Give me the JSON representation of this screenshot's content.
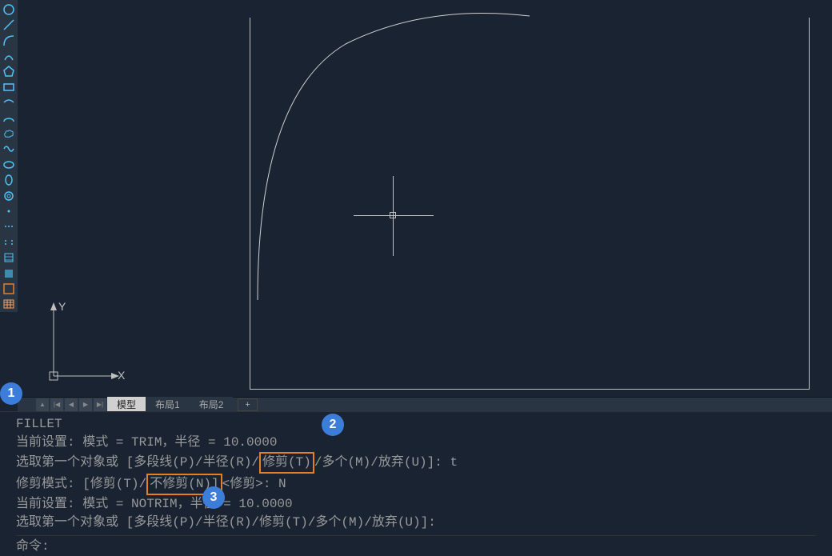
{
  "toolbar_icons": [
    "circle-icon",
    "line-icon",
    "arc-small-icon",
    "arc-outline-icon",
    "pentagon-icon",
    "rectangle-icon",
    "arc-icon",
    "ellipse-arc-icon",
    "cloud-icon",
    "spline-icon",
    "ellipse-icon",
    "ellipse2-icon",
    "revcloud-icon",
    "point-icon",
    "dots-icon",
    "dots2-icon",
    "hatch-icon",
    "gradient-icon",
    "block-icon",
    "table-icon"
  ],
  "ucs": {
    "x": "X",
    "y": "Y"
  },
  "nav": {
    "lock": "▲",
    "first": "|◀",
    "prev": "◀",
    "next": "▶",
    "last": "▶|"
  },
  "tabs": {
    "model": "模型",
    "layout1": "布局1",
    "layout2": "布局2",
    "add": "+"
  },
  "cmd": {
    "name": "FILLET",
    "line1_a": "当前设置: 模式 = TRIM，半径 = 10.0000",
    "line2_a": "选取第一个对象或 [多段线(P)/半径(R)/",
    "line2_h": "修剪(T)",
    "line2_b": "/多个(M)/放弃(U)]: t",
    "line3_a": "修剪模式: [修剪(T)/",
    "line3_h": "不修剪(N)]",
    "line3_b": "<修剪>: N",
    "line4": "当前设置: 模式 = NOTRIM，半径 = 10.0000",
    "line5": "选取第一个对象或 [多段线(P)/半径(R)/修剪(T)/多个(M)/放弃(U)]:",
    "prompt": "命令:"
  },
  "callouts": {
    "c1": "1",
    "c2": "2",
    "c3": "3"
  }
}
